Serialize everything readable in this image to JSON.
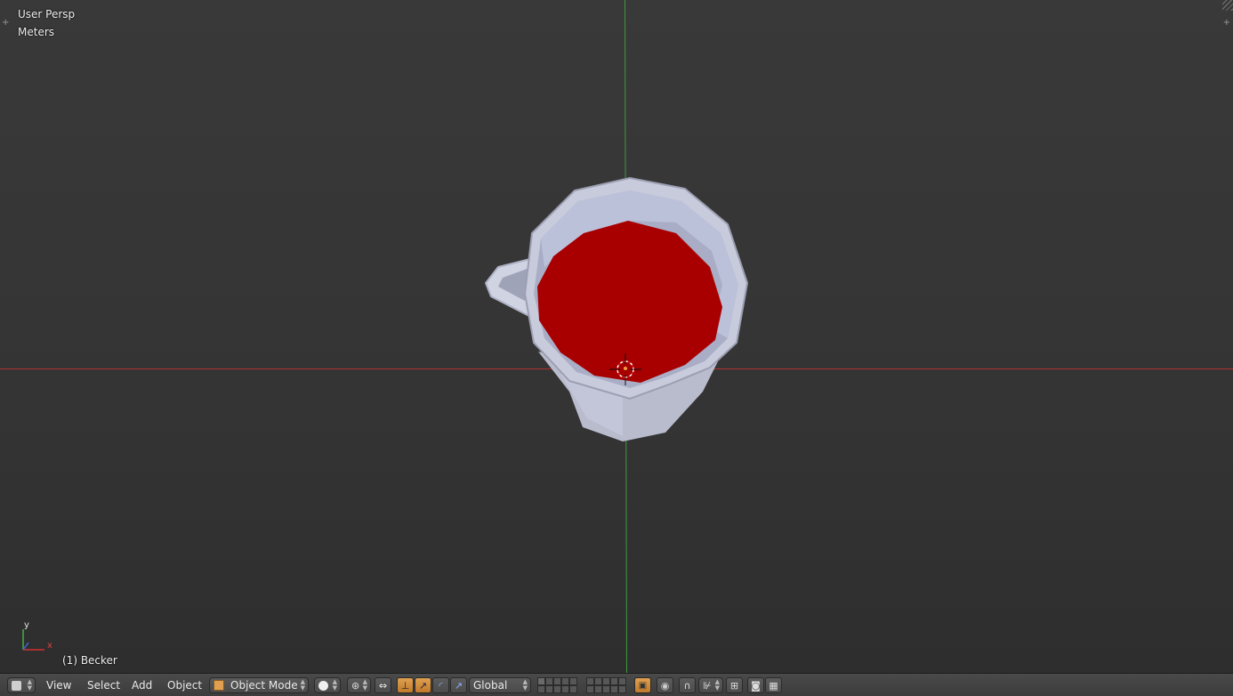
{
  "viewport": {
    "view_name": "User Persp",
    "units": "Meters",
    "object_info": "(1) Becker",
    "axis_labels": {
      "y": "y",
      "x": "x"
    },
    "colors": {
      "x_axis": "#c83232",
      "y_axis": "#3c9a3c",
      "liquid": "#a80000",
      "mug": "#c8ccde"
    }
  },
  "header": {
    "menus": {
      "view": "View",
      "select": "Select",
      "add": "Add",
      "object": "Object"
    },
    "mode_label": "Object Mode",
    "orientation_label": "Global",
    "icons": [
      "editor-type-icon",
      "viewport-shading-icon",
      "pivot-point-icon",
      "manipulator-icon",
      "translate-icon",
      "rotate-icon",
      "scale-icon",
      "layers-grid",
      "lock-icon",
      "proportional-edit-icon",
      "snap-icon",
      "snap-element-icon",
      "opengl-render-icon",
      "render-animation-icon"
    ]
  }
}
